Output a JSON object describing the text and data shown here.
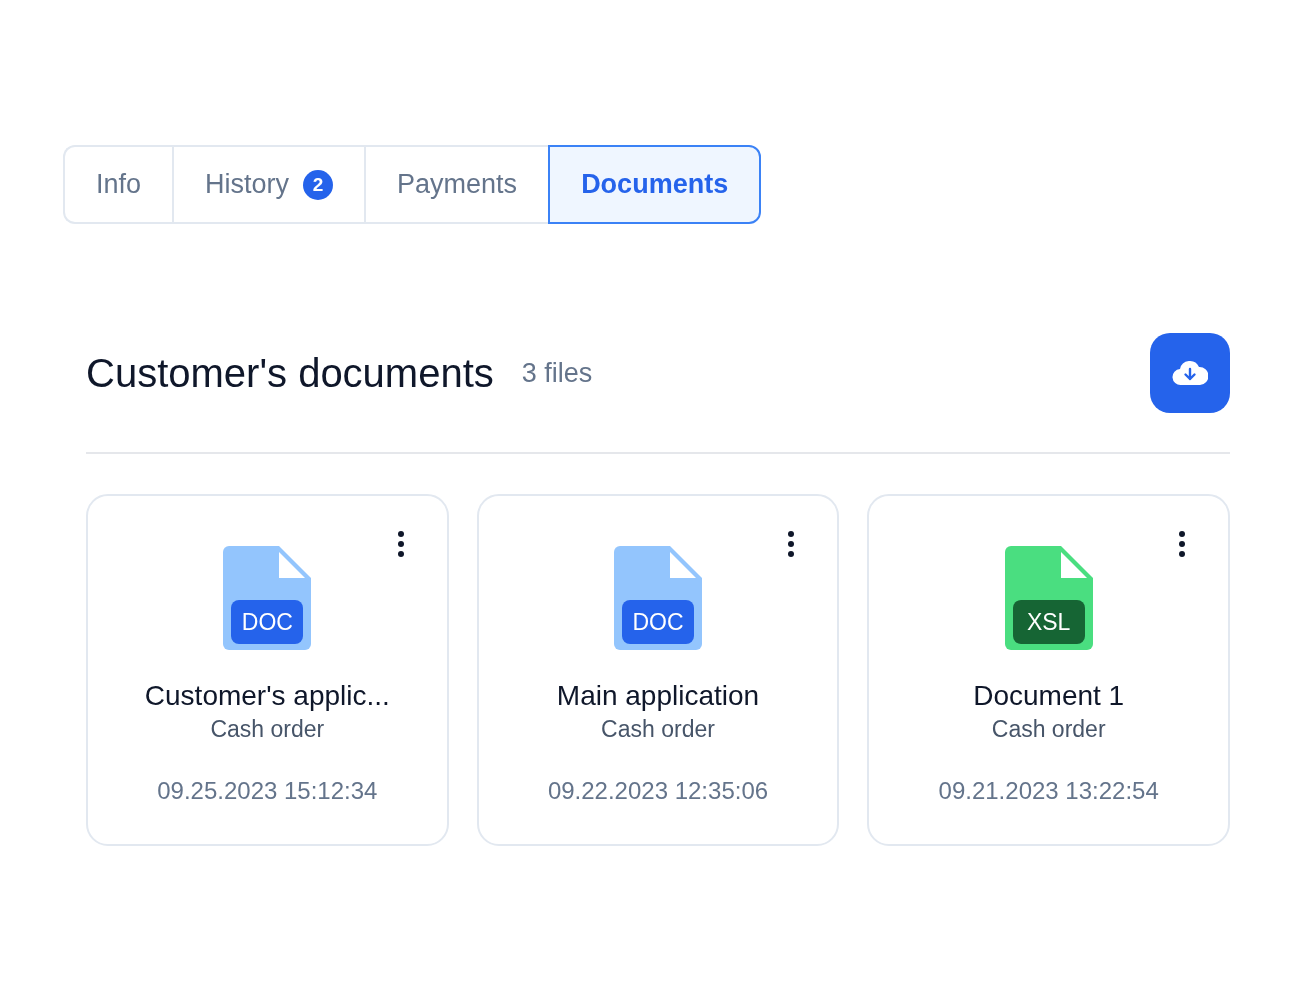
{
  "tabs": [
    {
      "label": "Info",
      "selected": false
    },
    {
      "label": "History",
      "selected": false,
      "badge": "2"
    },
    {
      "label": "Payments",
      "selected": false
    },
    {
      "label": "Documents",
      "selected": true
    }
  ],
  "section": {
    "title": "Customer's documents",
    "count": "3 files"
  },
  "files": [
    {
      "kind": "doc",
      "type_label": "DOC",
      "name": "Customer's applic...",
      "category": "Cash order",
      "date": "09.25.2023 15:12:34"
    },
    {
      "kind": "doc",
      "type_label": "DOC",
      "name": "Main application",
      "category": "Cash order",
      "date": "09.22.2023 12:35:06"
    },
    {
      "kind": "xsl",
      "type_label": "XSL",
      "name": "Document 1",
      "category": "Cash order",
      "date": "09.21.2023 13:22:54"
    }
  ]
}
